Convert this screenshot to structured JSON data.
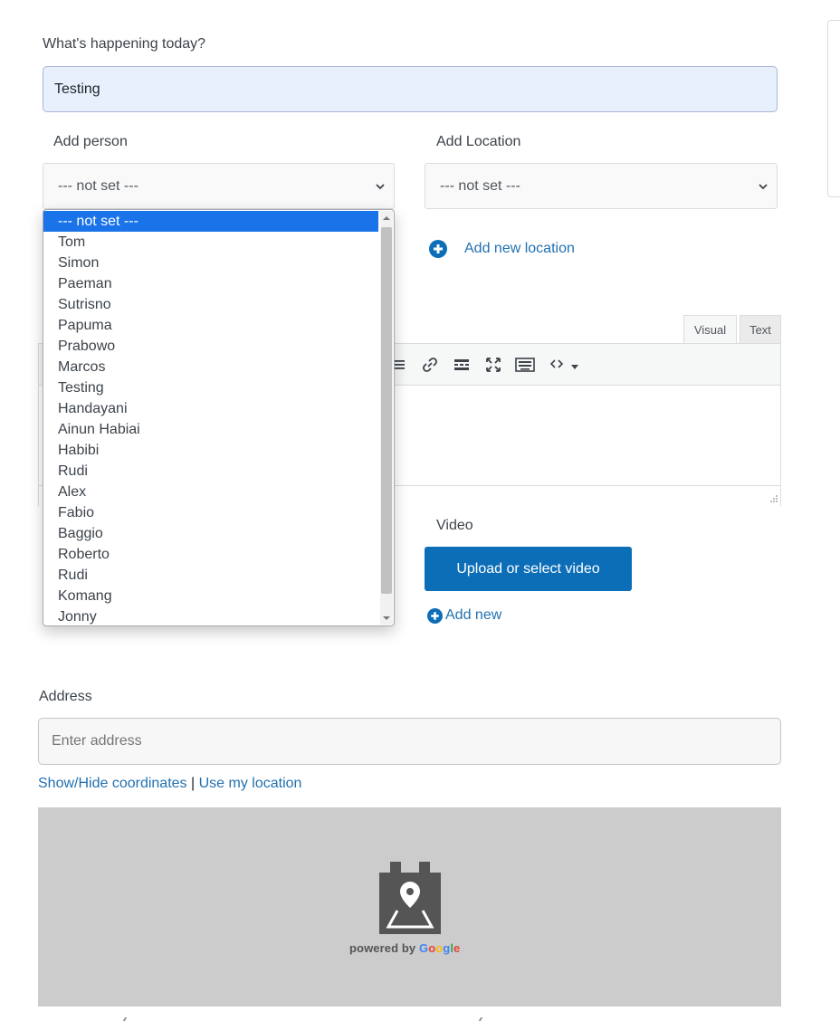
{
  "whats_happening": {
    "label": "What's happening today?",
    "value": "Testing"
  },
  "add_person": {
    "label": "Add person",
    "selected": "--- not set ---"
  },
  "add_location": {
    "label": "Add Location",
    "selected": "--- not set ---",
    "add_new_link": "Add new location"
  },
  "person_options": [
    "--- not set ---",
    "Tom",
    "Simon",
    "Paeman",
    "Sutrisno",
    "Papuma",
    "Prabowo",
    "Marcos",
    "Testing",
    "Handayani",
    "Ainun Habiai",
    "Habibi",
    "Rudi",
    "Alex",
    "Fabio",
    "Baggio",
    "Roberto",
    "Rudi",
    "Komang",
    "Jonny"
  ],
  "editor": {
    "tab_visual": "Visual",
    "tab_text": "Text"
  },
  "video": {
    "label": "Video",
    "upload_button": "Upload or select video",
    "add_new": "Add new"
  },
  "address": {
    "label": "Address",
    "placeholder": "Enter address",
    "show_hide_link": "Show/Hide coordinates",
    "separator": "|",
    "use_location_link": "Use my location"
  },
  "map": {
    "powered_by": "powered by",
    "brand": [
      "G",
      "o",
      "o",
      "g",
      "l",
      "e"
    ],
    "brand_colors": [
      "#4285F4",
      "#EA4335",
      "#FBBC05",
      "#4285F4",
      "#34A853",
      "#EA4335"
    ]
  },
  "colors": {
    "accent": "#0d6eb8",
    "link": "#2271b1",
    "selected_option": "#1a73e8"
  }
}
